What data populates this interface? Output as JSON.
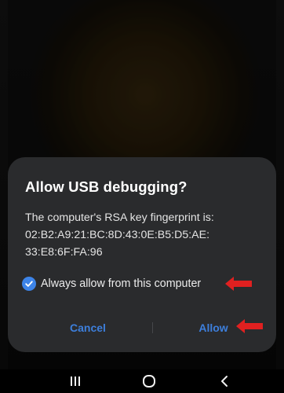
{
  "dialog": {
    "title": "Allow USB debugging?",
    "message_line1": "The computer's RSA key fingerprint is:",
    "message_line2": "02:B2:A9:21:BC:8D:43:0E:B5:D5:AE:",
    "message_line3": "33:E8:6F:FA:96",
    "checkbox_label": "Always allow from this computer",
    "checkbox_checked": true,
    "cancel_label": "Cancel",
    "allow_label": "Allow"
  },
  "navbar": {
    "recents_icon": "recents-icon",
    "home_icon": "home-icon",
    "back_icon": "back-icon"
  },
  "colors": {
    "accent": "#3d84e8",
    "annotation_arrow": "#e02020",
    "dialog_bg": "#2a2b2d"
  }
}
